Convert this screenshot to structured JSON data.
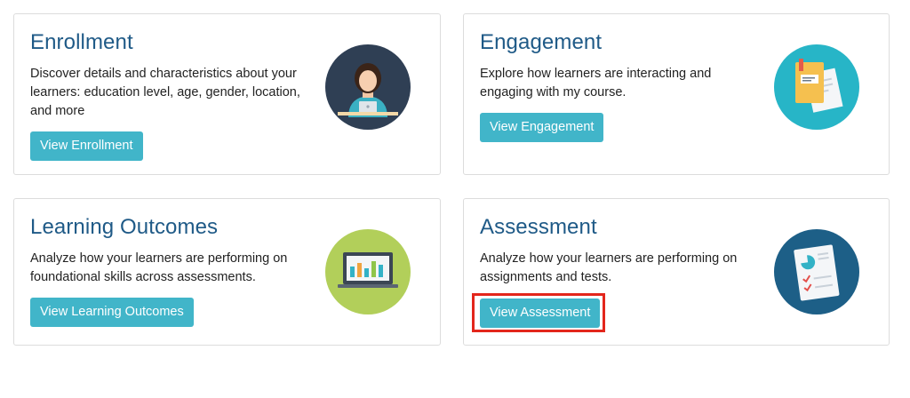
{
  "cards": [
    {
      "title": "Enrollment",
      "description": "Discover details and characteristics about your learners: education level, age, gender, location, and more",
      "button": "View Enrollment",
      "icon": "learner-at-desk-icon",
      "icon_bg": "#2f3f54"
    },
    {
      "title": "Engagement",
      "description": "Explore how learners are interacting and engaging with my course.",
      "button": "View Engagement",
      "icon": "documents-icon",
      "icon_bg": "#27b5c7"
    },
    {
      "title": "Learning Outcomes",
      "description": "Analyze how your learners are performing on foundational skills across assessments.",
      "button": "View Learning Outcomes",
      "icon": "laptop-chart-icon",
      "icon_bg": "#b2cf5a"
    },
    {
      "title": "Assessment",
      "description": "Analyze how your learners are performing on assignments and tests.",
      "button": "View Assessment",
      "icon": "report-checklist-icon",
      "icon_bg": "#1d5f87"
    }
  ],
  "colors": {
    "title": "#1f5a87",
    "button": "#41b5c9",
    "highlight": "#e3261c"
  }
}
